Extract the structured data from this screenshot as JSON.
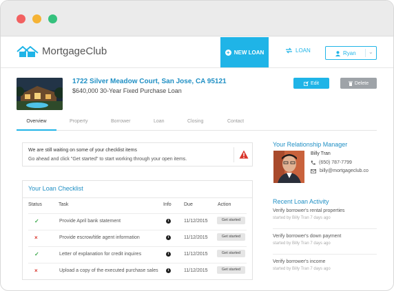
{
  "header": {
    "logo_text": "MortgageClub",
    "new_loan_label": "NEW LOAN",
    "loan_label": "LOAN",
    "user_name": "Ryan"
  },
  "property": {
    "address": "1722 Silver Meadow Court, San Jose, CA 95121",
    "loan_summary": "$640,000 30-Year Fixed Purchase Loan",
    "edit_label": "Edit",
    "delete_label": "Delete"
  },
  "tabs": [
    "Overview",
    "Property",
    "Borrower",
    "Loan",
    "Closing",
    "Contact"
  ],
  "alert": {
    "title": "We are still waiting on some of your checklist items",
    "text": "Go ahead and click \"Get started\" to start working through your open items."
  },
  "checklist": {
    "title": "Your Loan Checklist",
    "columns": [
      "Status",
      "Task",
      "Info",
      "Due",
      "Action"
    ],
    "rows": [
      {
        "status": "done",
        "task": "Provide April bank statement",
        "info": "i",
        "due": "11/12/2015",
        "action": "Get started"
      },
      {
        "status": "pending",
        "task": "Provide escrow/title agent information",
        "info": "i",
        "due": "11/12/2015",
        "action": "Get started"
      },
      {
        "status": "done",
        "task": "Letter of explanation for credit inquires",
        "info": "i",
        "due": "11/12/2015",
        "action": "Get started"
      },
      {
        "status": "pending",
        "task": "Upload a copy of the executed purchase sales",
        "info": "i",
        "due": "11/12/2015",
        "action": "Get started"
      }
    ]
  },
  "manager": {
    "title": "Your Relationship Manager",
    "name": "Billy Tran",
    "phone": "(650) 787-7799",
    "email": "billy@mortgageclub.co"
  },
  "activity": {
    "title": "Recent Loan Activity",
    "items": [
      {
        "text": "Verify borrower's rental properties",
        "meta": "started by Billy Tran 7 days ago"
      },
      {
        "text": "Verify borrower's down payment",
        "meta": "started by Billy Tran 7 days ago"
      },
      {
        "text": "Verify borrower's income",
        "meta": "started by Billy Tran 7 days ago"
      }
    ]
  },
  "colors": {
    "accent": "#1fb4e7",
    "link": "#1f8fc4",
    "done": "#3aa84a",
    "pending": "#d9352b"
  }
}
